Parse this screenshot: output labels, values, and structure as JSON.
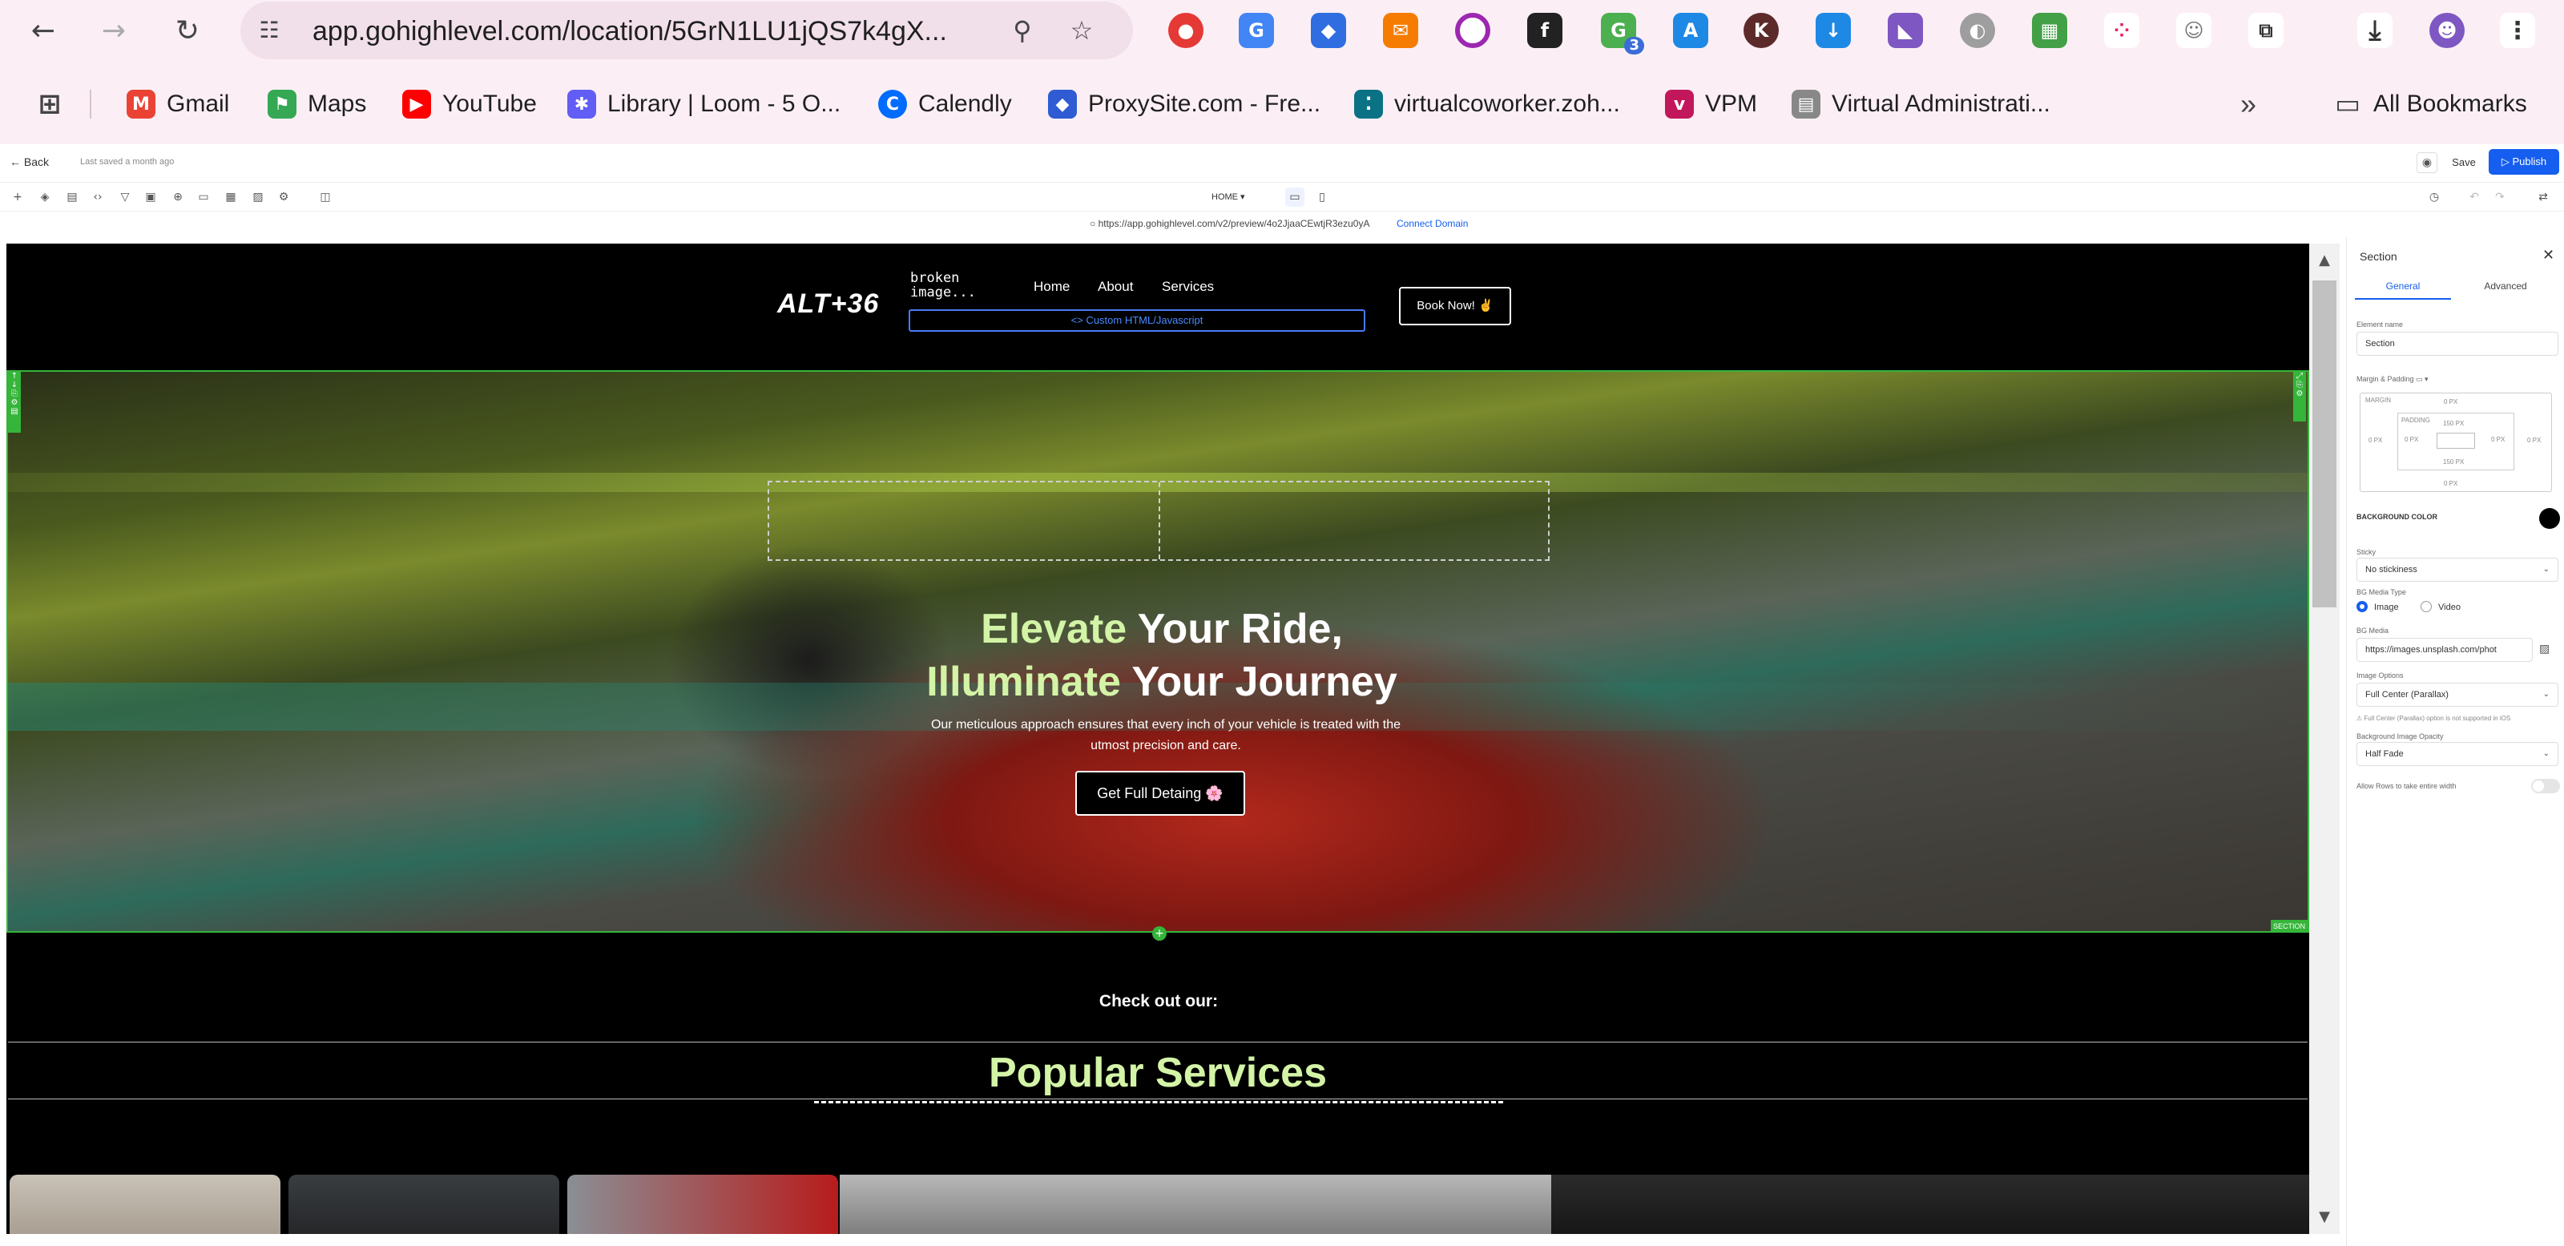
{
  "browser": {
    "url": "app.gohighlevel.com/location/5GrN1LU1jQS7k4gX...",
    "bookmarks": [
      {
        "label": "Gmail",
        "icon": "gmail-icon",
        "color": "#ea4335"
      },
      {
        "label": "Maps",
        "icon": "maps-icon",
        "color": "#34a853"
      },
      {
        "label": "YouTube",
        "icon": "youtube-icon",
        "color": "#ff0000"
      },
      {
        "label": "Library | Loom - 5 O...",
        "icon": "loom-icon",
        "color": "#625df5"
      },
      {
        "label": "Calendly",
        "icon": "calendly-icon",
        "color": "#006bff"
      },
      {
        "label": "ProxySite.com - Fre...",
        "icon": "proxysite-icon",
        "color": "#2f5bd3"
      },
      {
        "label": "virtualcoworker.zoh...",
        "icon": "zoho-icon",
        "color": "#0b7285"
      },
      {
        "label": "VPM",
        "icon": "vpm-icon",
        "color": "#c2185b"
      },
      {
        "label": "Virtual Administrati...",
        "icon": "document-icon",
        "color": "#555555"
      }
    ],
    "all_bookmarks": "All Bookmarks",
    "extensions_badge": "3"
  },
  "app": {
    "back": "Back",
    "last_saved": "Last saved a month ago",
    "save": "Save",
    "publish": "Publish",
    "page_select": "HOME",
    "preview_url": "https://app.gohighlevel.com/v2/preview/4o2JjaaCEwtjR3ezu0yA",
    "connect_domain": "Connect Domain"
  },
  "site": {
    "logo": "ALT+36",
    "broken_image": "broken image...",
    "nav": [
      "Home",
      "About",
      "Services"
    ],
    "custom_html": "<> Custom HTML/Javascript",
    "book_now": "Book Now! ✌",
    "hero": {
      "title_hl_1": "Elevate",
      "title_rest_1": " Your Ride,",
      "title_hl_2": "Illuminate",
      "title_rest_2": " Your Journey",
      "subtitle": "Our meticulous approach ensures that every inch of your vehicle is treated with the utmost precision and care.",
      "cta": "Get Full Detaing 🌸"
    },
    "section_label": "SECTION",
    "check_out": "Check out our:",
    "popular": "Popular Services"
  },
  "panel": {
    "title": "Section",
    "tabs": [
      "General",
      "Advanced"
    ],
    "element_name_label": "Element name",
    "element_name": "Section",
    "margin_padding_label": "Margin & Padding",
    "margin_label": "MARGIN",
    "padding_label": "PADDING",
    "margin_top": "0 PX",
    "margin_bottom": "0 PX",
    "margin_left": "0 PX",
    "margin_right": "0 PX",
    "padding_top": "150 PX",
    "padding_bottom": "150 PX",
    "padding_left": "0 PX",
    "padding_right": "0 PX",
    "bg_color_label": "BACKGROUND COLOR",
    "bg_color": "#000000",
    "sticky_label": "Sticky",
    "sticky": "No stickiness",
    "bg_media_type_label": "BG Media Type",
    "bg_media_options": [
      "Image",
      "Video"
    ],
    "bg_media_label": "BG Media",
    "bg_media": "https://images.unsplash.com/phot",
    "image_options_label": "Image Options",
    "image_options": "Full Center (Parallax)",
    "parallax_note": "Full Center (Parallax) option is not supported in iOS",
    "bg_opacity_label": "Background Image Opacity",
    "bg_opacity": "Half Fade",
    "rows_full_width_label": "Allow Rows to take entire width"
  }
}
